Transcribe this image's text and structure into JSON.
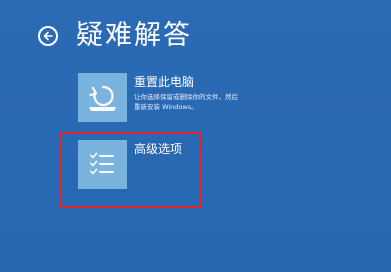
{
  "header": {
    "title": "疑难解答",
    "back_icon": "back-arrow-circle-icon"
  },
  "options": [
    {
      "title": "重置此电脑",
      "description_line1": "让你选择保留或删除你的文件，然后",
      "description_line2": "重新安装 Windows。",
      "icon": "reset-pc-icon"
    },
    {
      "title": "高级选项",
      "icon": "checklist-icon"
    }
  ],
  "colors": {
    "background": "#2a68b2",
    "tile": "#7ab3de",
    "highlight": "#e0242b",
    "text": "#ffffff"
  }
}
